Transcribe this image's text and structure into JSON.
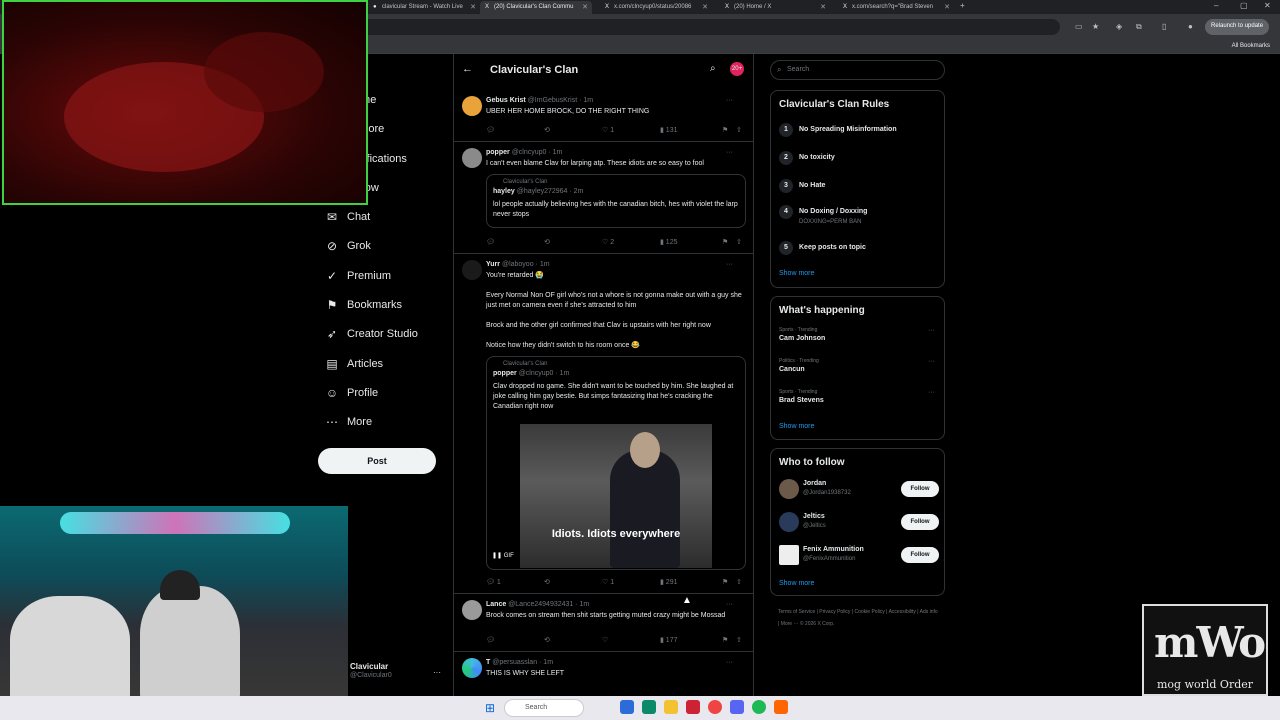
{
  "browser": {
    "tabs": [
      {
        "label": "clavicular Stream - Watch Live"
      },
      {
        "label": "(20) Clavicular's Clan Commu"
      },
      {
        "label": "x.com/clncyup0/status/20086"
      },
      {
        "label": "(20) Home / X"
      },
      {
        "label": "x.com/search?q=\"Brad Steven"
      }
    ],
    "relaunch": "Relaunch to update",
    "all_bookmarks": "All Bookmarks"
  },
  "nav": {
    "items": [
      {
        "label": "Home",
        "icon": "home-icon"
      },
      {
        "label": "Explore",
        "icon": "explore-icon"
      },
      {
        "label": "Notifications",
        "icon": "bell-icon"
      },
      {
        "label": "Follow",
        "icon": "follow-icon"
      },
      {
        "label": "Chat",
        "icon": "mail-icon"
      },
      {
        "label": "Grok",
        "icon": "grok-icon"
      },
      {
        "label": "Premium",
        "icon": "check-icon"
      },
      {
        "label": "Bookmarks",
        "icon": "bookmark-icon"
      },
      {
        "label": "Creator Studio",
        "icon": "rocket-icon"
      },
      {
        "label": "Articles",
        "icon": "article-icon"
      },
      {
        "label": "Profile",
        "icon": "person-icon"
      },
      {
        "label": "More",
        "icon": "more-icon"
      }
    ],
    "post_button": "Post",
    "account": {
      "name": "Clavicular",
      "handle": "@Clavicular0"
    }
  },
  "feed": {
    "title": "Clavicular's Clan",
    "badge": "20+",
    "posts": [
      {
        "name": "Gebus Krist",
        "handle": "@ImGebusKrist · 1m",
        "text": "UBER HER HOME BROCK, DO THE RIGHT THING",
        "likes": "1",
        "views": "131"
      },
      {
        "name": "popper",
        "handle": "@clncyup0 · 1m",
        "text": "I can't even blame Clav for larping atp. These idiots are so easy to fool",
        "quote": {
          "community": "Clavicular's Clan",
          "name": "hayley",
          "handle": "@hayley272964 · 2m",
          "text": "lol people actually believing hes with the canadian bitch, hes with violet the larp never stops"
        },
        "likes": "2",
        "views": "125"
      },
      {
        "name": "Yurr",
        "handle": "@laboyoo · 1m",
        "text1": "You're retarded 😭",
        "text2": "Every Normal Non OF girl who's not a whore is not gonna make out with a guy she just met on camera even if she's attracted to him",
        "text3": "Brock and the other girl confirmed that Clav is upstairs with her right now",
        "text4": "Notice how they didn't switch to his room once 😂",
        "quote": {
          "community": "Clavicular's Clan",
          "name": "popper",
          "handle": "@clncyup0 · 1m",
          "text": "Clav dropped no game. She didn't want to be touched by him. She laughed at joke calling him gay bestie. But simps fantasizing that he's cracking the Canadian right now",
          "gif_caption": "Idiots. Idiots everywhere",
          "gif_label": "GIF"
        },
        "replies": "1",
        "likes": "1",
        "views": "291"
      },
      {
        "name": "Lance",
        "handle": "@Lance2494932431 · 1m",
        "text": "Brock comes on stream then shit starts getting muted crazy might be Mossad",
        "views": "177"
      },
      {
        "name": "T",
        "handle": "@persuasslan · 1m",
        "text": "THIS IS WHY SHE LEFT"
      }
    ]
  },
  "right": {
    "search_placeholder": "Search",
    "rules": {
      "title": "Clavicular's Clan Rules",
      "items": [
        {
          "n": "1",
          "text": "No Spreading Misinformation"
        },
        {
          "n": "2",
          "text": "No toxicity"
        },
        {
          "n": "3",
          "text": "No Hate"
        },
        {
          "n": "4",
          "text": "No Doxing / Doxxing",
          "sub": "DOXXING=PERM BAN"
        },
        {
          "n": "5",
          "text": "Keep posts on topic"
        }
      ],
      "show_more": "Show more"
    },
    "happening": {
      "title": "What's happening",
      "trends": [
        {
          "cat": "Sports · Trending",
          "name": "Cam Johnson"
        },
        {
          "cat": "Politics · Trending",
          "name": "Cancun"
        },
        {
          "cat": "Sports · Trending",
          "name": "Brad Stevens"
        }
      ],
      "show_more": "Show more"
    },
    "follow": {
      "title": "Who to follow",
      "people": [
        {
          "name": "Jordan",
          "handle": "@Jordan1938732"
        },
        {
          "name": "Jeltics",
          "handle": "@Jeltics"
        },
        {
          "name": "Fenix Ammunition",
          "handle": "@FenixAmmunition"
        }
      ],
      "button": "Follow",
      "show_more": "Show more"
    },
    "footer": "Terms of Service | Privacy Policy | Cookie Policy | Accessibility | Ads info | More ··· © 2026 X Corp."
  },
  "overlay": {
    "logo_big": "mWo",
    "logo_small": "mog world Order"
  },
  "taskbar": {
    "search": "Search"
  }
}
